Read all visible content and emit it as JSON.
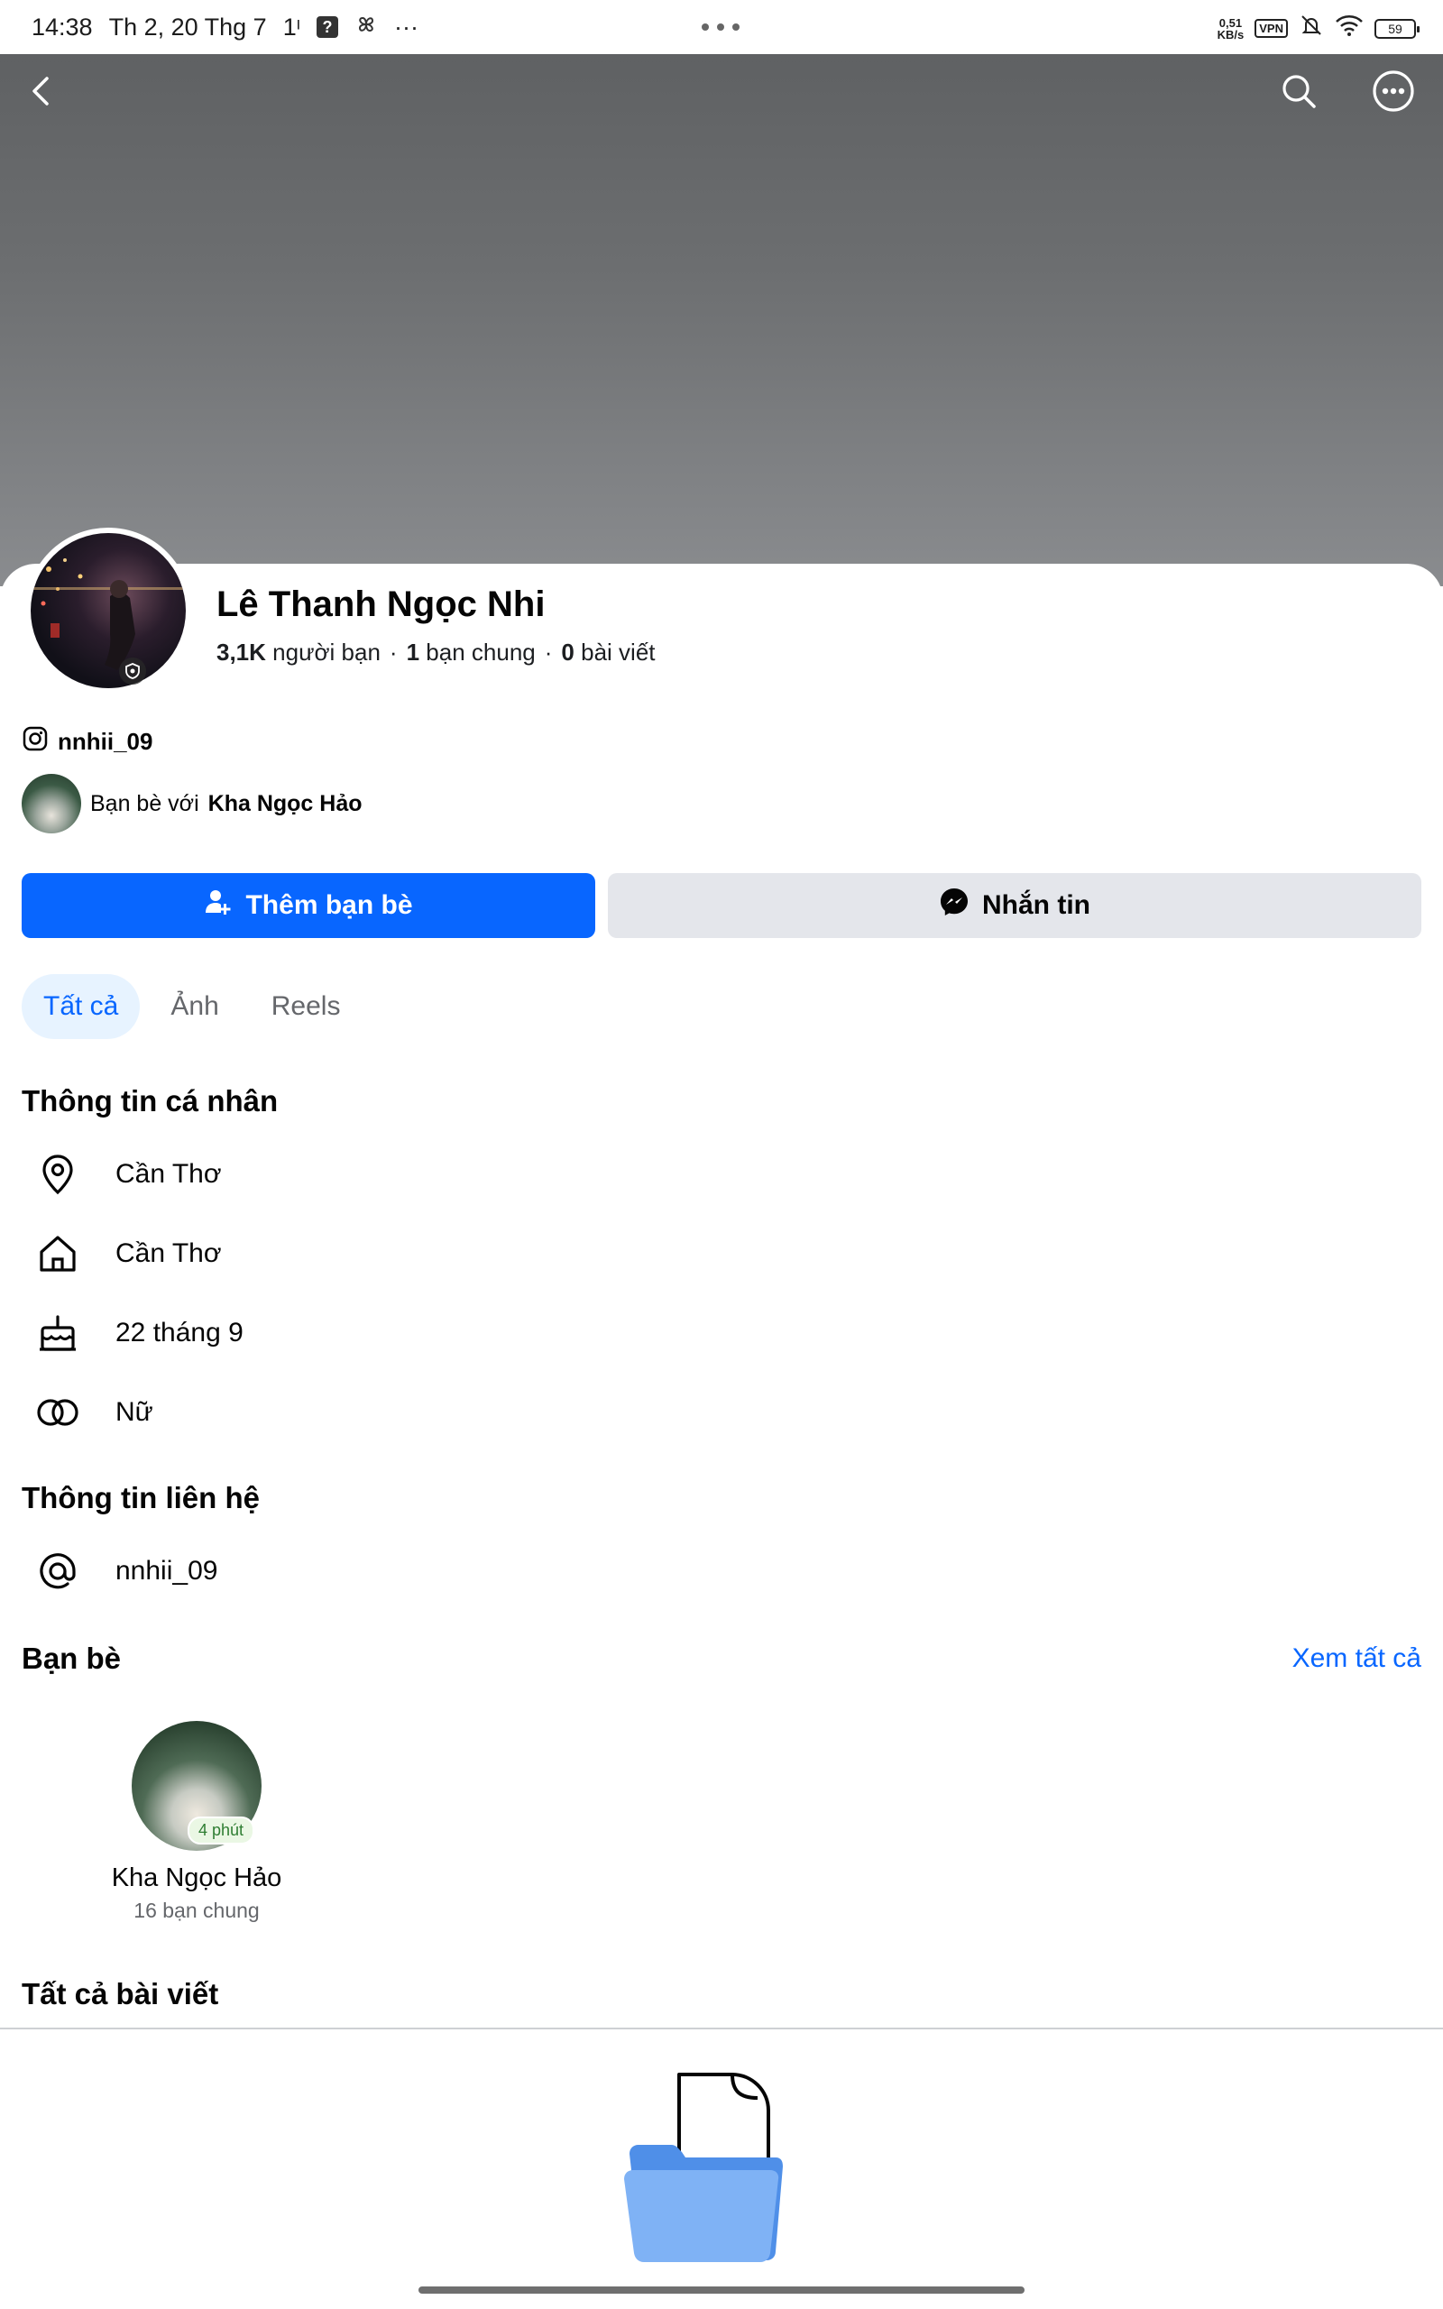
{
  "status_bar": {
    "time": "14:38",
    "date": "Th 2, 20 Thg 7",
    "signal": "1ᶦ",
    "notif_box": "?",
    "speed_top": "0,51",
    "speed_bottom": "KB/s",
    "vpn": "VPN",
    "battery": "59"
  },
  "profile": {
    "name": "Lê Thanh Ngọc Nhi",
    "friends_count": "3,1K",
    "friends_label": "người bạn",
    "mutual_count": "1",
    "mutual_label": "bạn chung",
    "posts_count": "0",
    "posts_label": "bài viết",
    "separator": "·",
    "instagram": "nnhii_09",
    "friends_with_prefix": "Bạn bè với",
    "friends_with_name": "Kha Ngọc Hảo"
  },
  "actions": {
    "add_friend": "Thêm bạn bè",
    "message": "Nhắn tin"
  },
  "tabs": [
    {
      "label": "Tất cả",
      "active": true
    },
    {
      "label": "Ảnh",
      "active": false
    },
    {
      "label": "Reels",
      "active": false
    }
  ],
  "personal_info": {
    "title": "Thông tin cá nhân",
    "items": [
      {
        "icon": "location-pin-icon",
        "text": "Cần Thơ"
      },
      {
        "icon": "home-icon",
        "text": "Cần Thơ"
      },
      {
        "icon": "birthday-cake-icon",
        "text": "22 tháng 9"
      },
      {
        "icon": "gender-icon",
        "text": "Nữ"
      }
    ]
  },
  "contact_info": {
    "title": "Thông tin liên hệ",
    "items": [
      {
        "icon": "at-sign-icon",
        "text": "nnhii_09"
      }
    ]
  },
  "friends": {
    "title": "Bạn bè",
    "see_all": "Xem tất cả",
    "items": [
      {
        "name": "Kha Ngọc Hảo",
        "mutual": "16 bạn chung",
        "badge": "4 phút"
      }
    ]
  },
  "posts": {
    "title": "Tất cả bài viết"
  },
  "colors": {
    "primary": "#0866ff",
    "secondary_button": "#e4e6eb",
    "active_tab_bg": "#e7f3ff",
    "text": "#050505",
    "muted": "#65676b"
  }
}
